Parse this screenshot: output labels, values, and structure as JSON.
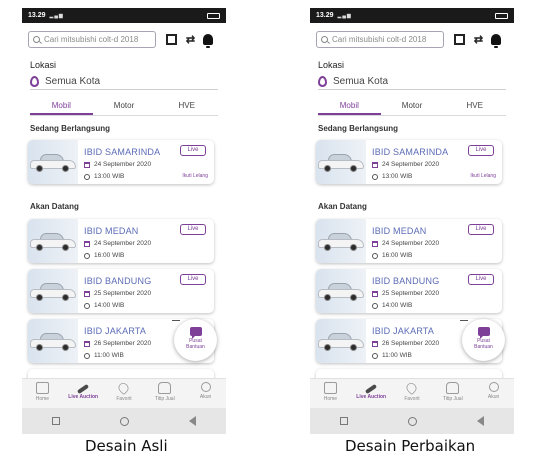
{
  "status_time": "13.29",
  "search_placeholder": "Cari mitsubishi colt-d 2018",
  "location": {
    "label": "Lokasi",
    "value": "Semua Kota"
  },
  "tabs": [
    "Mobil",
    "Motor",
    "HVE"
  ],
  "sections": {
    "ongoing": "Sedang Berlangsung",
    "upcoming": "Akan Datang"
  },
  "live_card": {
    "title": "IBID SAMARINDA",
    "date": "24 September 2020",
    "time": "13:00 WIB",
    "badge": "Live",
    "action": "Ikuti Lelang"
  },
  "upcoming_cards": [
    {
      "title": "IBID MEDAN",
      "date": "24 September 2020",
      "time": "16:00 WIB",
      "badge": "Live"
    },
    {
      "title": "IBID BANDUNG",
      "date": "25 September 2020",
      "time": "14:00 WIB",
      "badge": "Live"
    },
    {
      "title": "IBID JAKARTA",
      "date": "26 September 2020",
      "time": "11:00 WIB",
      "badge": "Live"
    }
  ],
  "fab": {
    "line1": "Pusat",
    "line2": "Bantuan"
  },
  "nav": [
    "Home",
    "Live Auction",
    "Favorit",
    "Titip Jual",
    "Akun"
  ],
  "captions": {
    "left": "Desain Asli",
    "right": "Desain Perbaikan"
  },
  "colors": {
    "accent": "#7d3f98",
    "title": "#5b6bb5"
  }
}
